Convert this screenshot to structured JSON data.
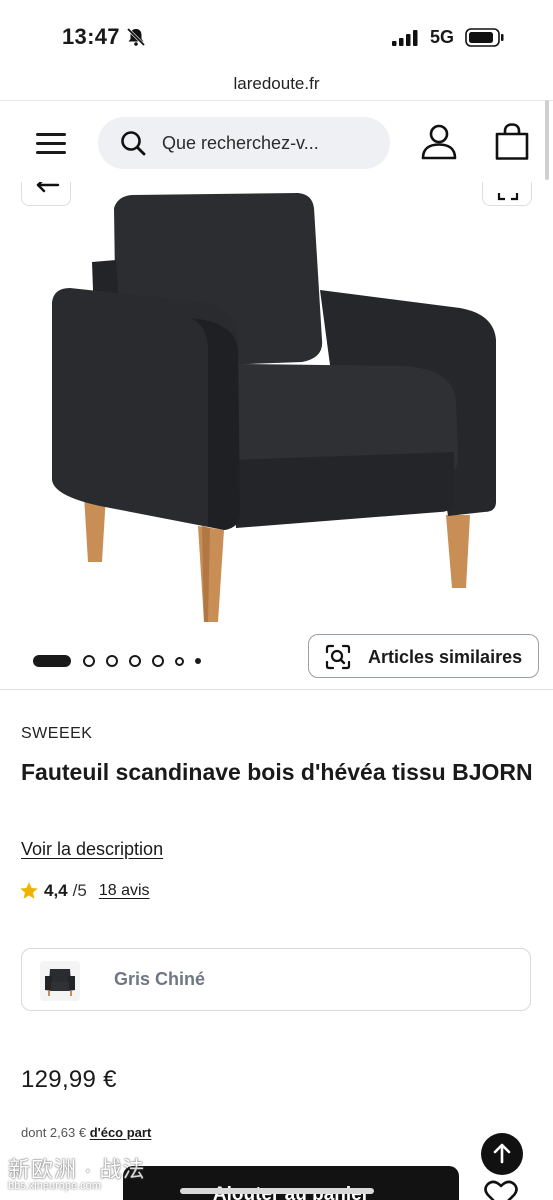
{
  "status_bar": {
    "time": "13:47",
    "network": "5G",
    "icons": [
      "bell-off-icon",
      "signal-icon",
      "battery-icon"
    ]
  },
  "browser": {
    "url": "laredoute.fr"
  },
  "header": {
    "search_placeholder": "Que recherchez-v...",
    "icons": [
      "menu-icon",
      "search-icon",
      "user-icon",
      "bag-icon"
    ]
  },
  "gallery": {
    "similar_label": "Articles similaires",
    "image_count": 7,
    "active_index": 0
  },
  "product": {
    "brand": "SWEEEK",
    "title": "Fauteuil scandinave bois d'hévéa tissu BJORN",
    "description_link": "Voir la description",
    "rating_value": "4,4",
    "rating_max": "/5",
    "reviews_link": "18 avis",
    "variant_label": "Gris Chiné",
    "price": "129,99 €",
    "eco_prefix": "dont 2,63 €",
    "eco_link": "d'éco part"
  },
  "actions": {
    "add_to_cart": "Ajouter au panier"
  },
  "watermark": {
    "title": "新欧洲 · 战法",
    "subtitle": "bbs.xineurope.com"
  },
  "colors": {
    "primary": "#121212",
    "star": "#f0b400",
    "muted": "#6f7785",
    "search_bg": "#eef0f3"
  }
}
